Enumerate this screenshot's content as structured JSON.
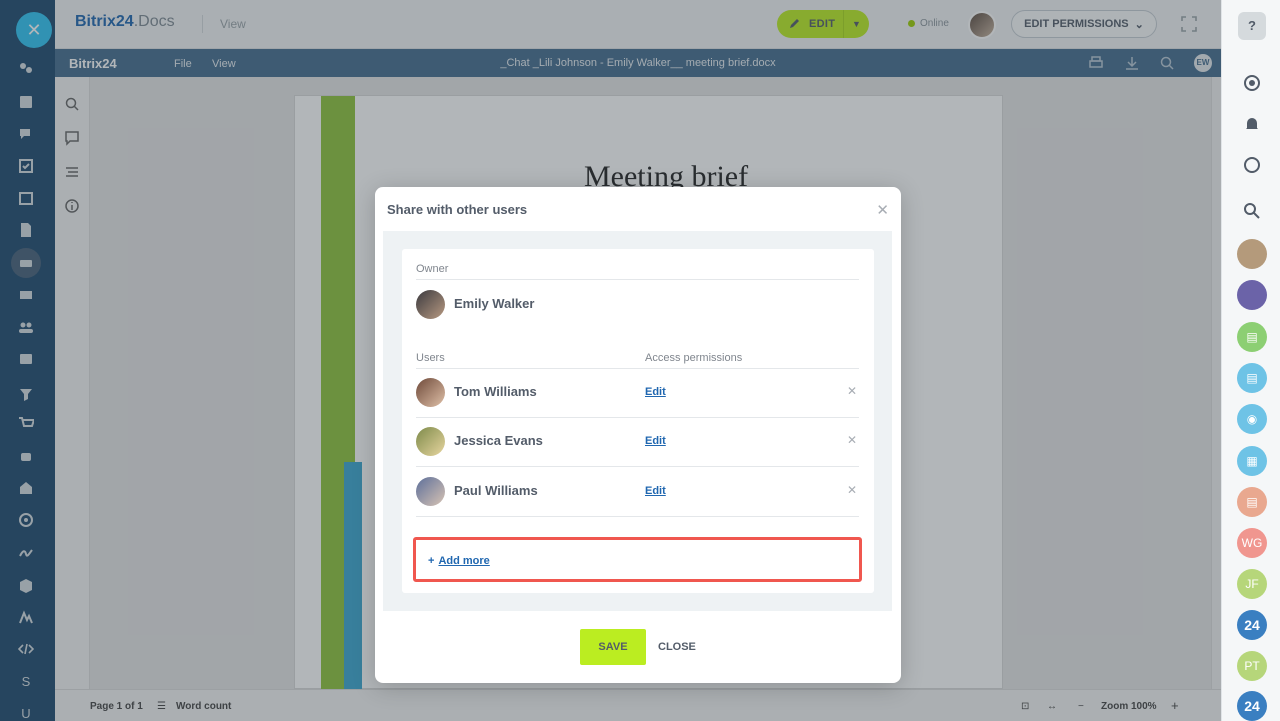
{
  "app": {
    "brand_main": "Bitrix24",
    "brand_suffix": ".Docs",
    "view_label": "View",
    "edit_button": "EDIT",
    "online_status": "Online",
    "edit_permissions_button": "EDIT PERMISSIONS"
  },
  "editor": {
    "logo": "Bitrix24",
    "menu": [
      "File",
      "View"
    ],
    "file_title": "_Chat _Lili Johnson - Emily Walker__ meeting brief.docx",
    "user_initials": "EW",
    "doc_heading": "Meeting brief",
    "page_indicator": "Page 1 of 1",
    "word_count": "Word count",
    "zoom": "Zoom 100%"
  },
  "left_rail": {
    "letters": [
      "S",
      "U"
    ]
  },
  "right_rail": {
    "help": "?",
    "avatars": [
      "WG",
      "JF",
      "24",
      "PT",
      "24"
    ],
    "colors": {
      "WG": "#f0968f",
      "JF": "#b6d67a",
      "24": "#3a7fc1",
      "PT": "#b6d67a"
    }
  },
  "dialog": {
    "title": "Share with other users",
    "owner_label": "Owner",
    "owner_name": "Emily Walker",
    "users_label": "Users",
    "access_label": "Access permissions",
    "users": [
      {
        "name": "Tom Williams",
        "permission": "Edit"
      },
      {
        "name": "Jessica Evans",
        "permission": "Edit"
      },
      {
        "name": "Paul Williams",
        "permission": "Edit"
      }
    ],
    "add_more": "Add more",
    "save": "SAVE",
    "close": "CLOSE"
  },
  "colors": {
    "accent_green": "#bbed21",
    "link_blue": "#2067b0",
    "highlight_red": "#f0574f"
  }
}
